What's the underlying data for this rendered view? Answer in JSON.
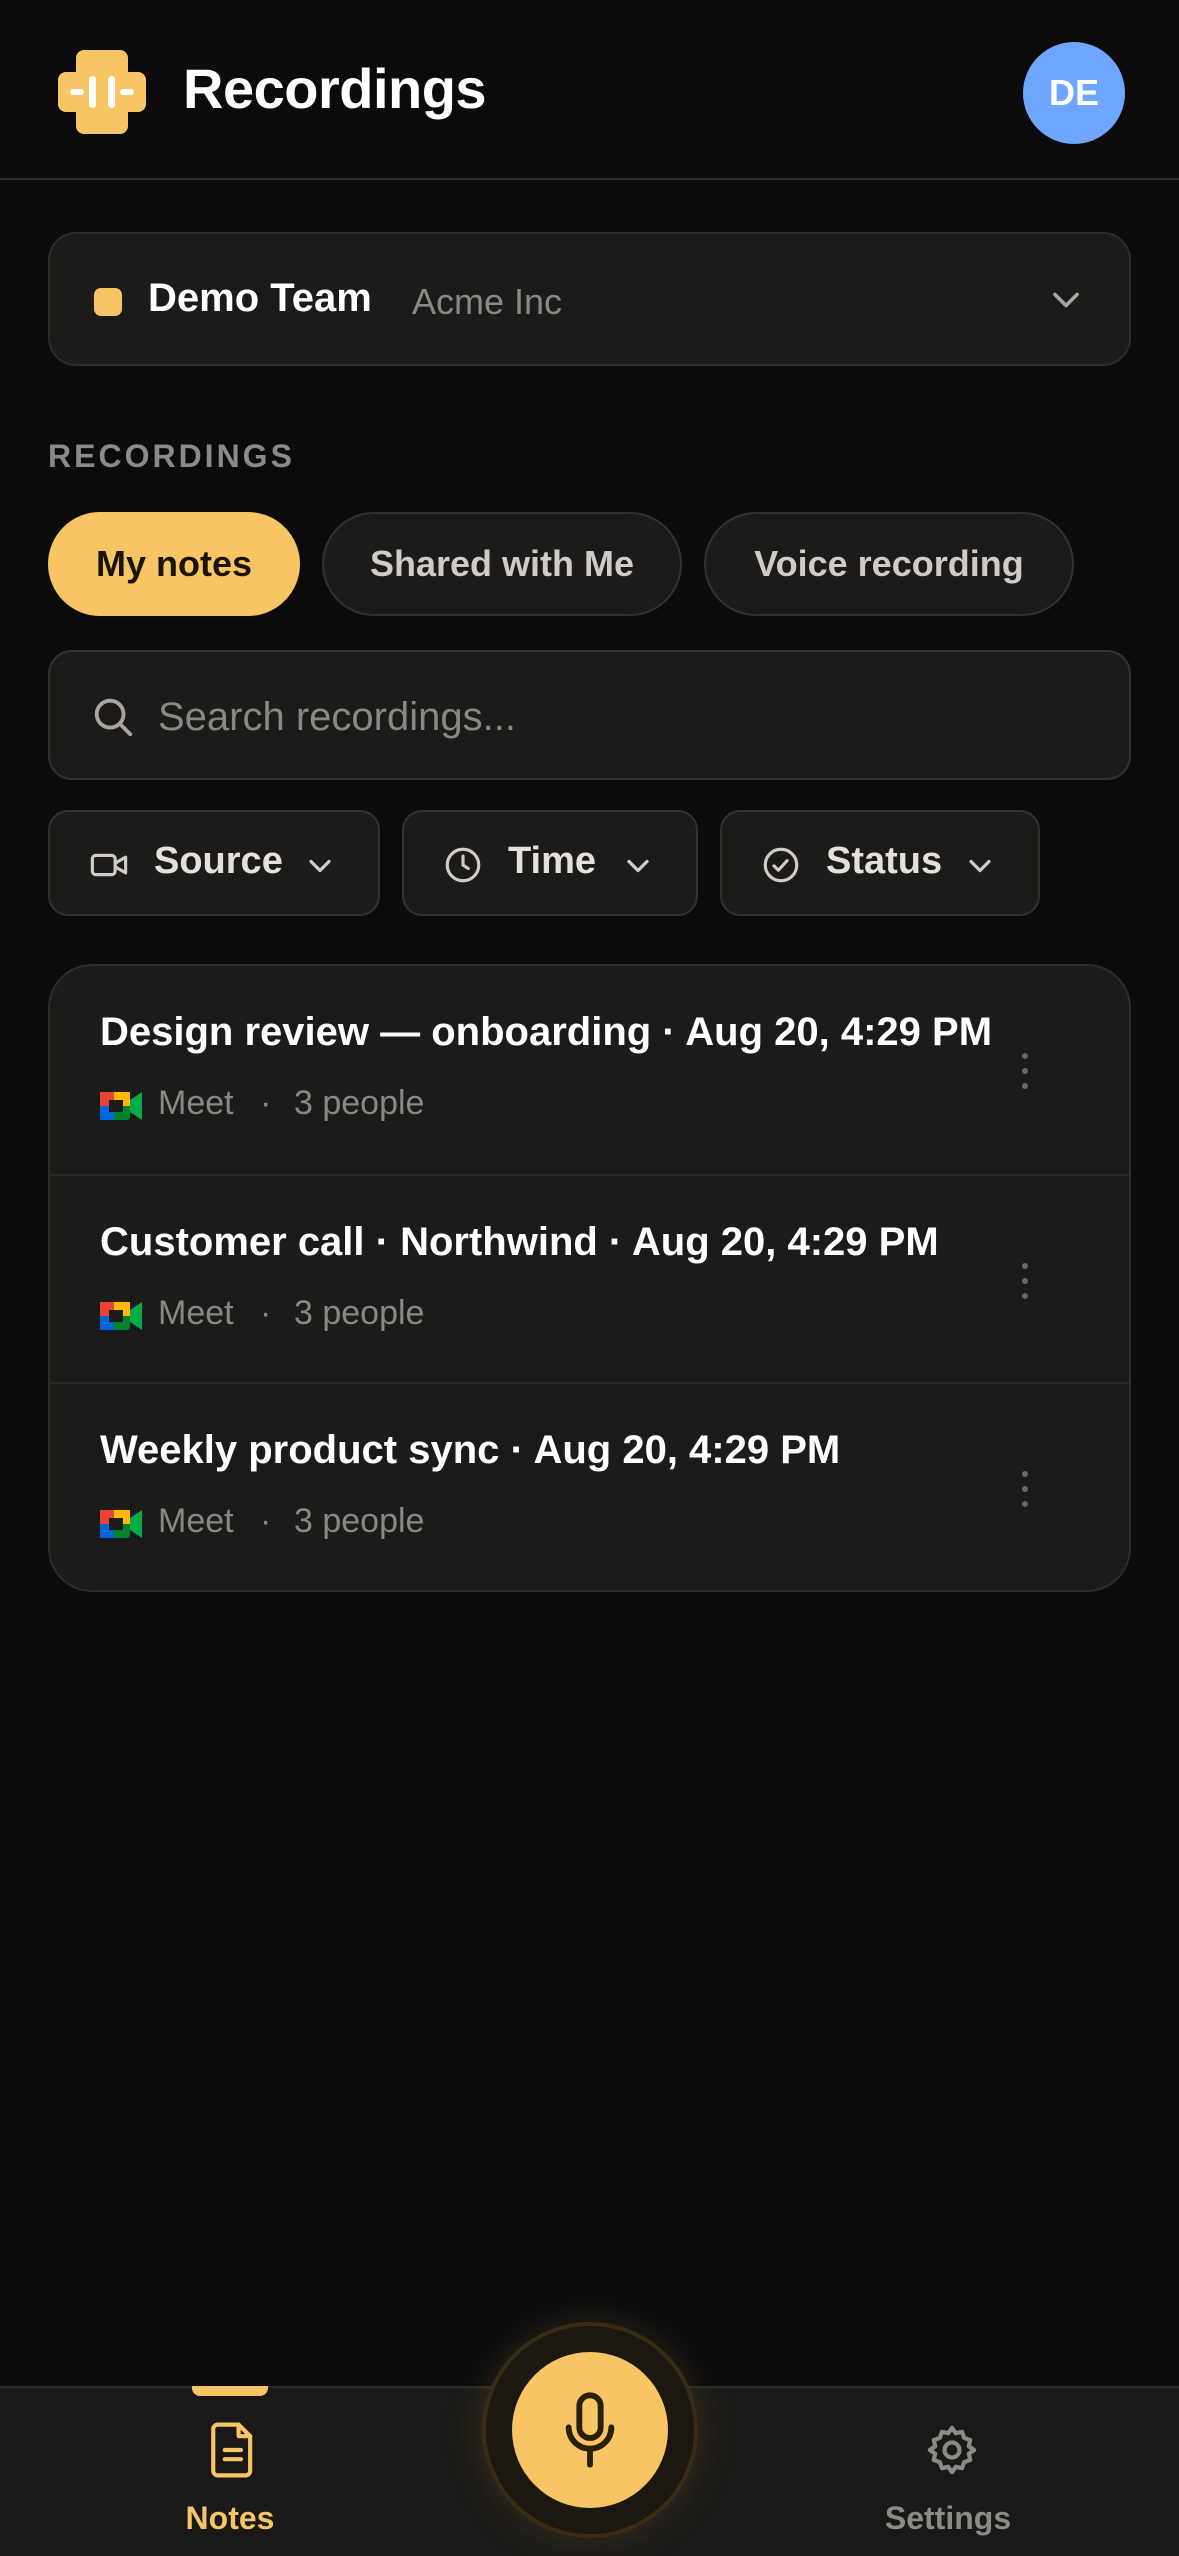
{
  "colors": {
    "accent": "#f7c563",
    "background": "#0b0b0c",
    "surface": "#1c1b19",
    "avatar": "#6ea6ff"
  },
  "header": {
    "title": "Recordings",
    "avatar_initials": "DE",
    "logo_icon": "waveform-logo-icon"
  },
  "team": {
    "name": "Demo Team",
    "org": "Acme Inc",
    "icon": "chevron-down-icon"
  },
  "section": {
    "label": "RECORDINGS"
  },
  "tabs": [
    {
      "label": "My notes",
      "active": true
    },
    {
      "label": "Shared with Me",
      "active": false
    },
    {
      "label": "Voice recording",
      "active": false
    }
  ],
  "search": {
    "placeholder": "Search recordings...",
    "value": ""
  },
  "filters": [
    {
      "label": "Source",
      "icon": "video-camera-icon"
    },
    {
      "label": "Time",
      "icon": "clock-icon"
    },
    {
      "label": "Status",
      "icon": "check-circle-icon"
    }
  ],
  "recordings": [
    {
      "title": "Design review — onboarding · Aug 20, 4:29 PM",
      "source": "Meet",
      "separator": "·",
      "people": "3 people"
    },
    {
      "title": "Customer call · Northwind · Aug 20, 4:29 PM",
      "source": "Meet",
      "separator": "·",
      "people": "3 people"
    },
    {
      "title": "Weekly product sync · Aug 20, 4:29 PM",
      "source": "Meet",
      "separator": "·",
      "people": "3 people"
    }
  ],
  "nav": {
    "notes_label": "Notes",
    "settings_label": "Settings",
    "record_icon": "microphone-icon"
  }
}
